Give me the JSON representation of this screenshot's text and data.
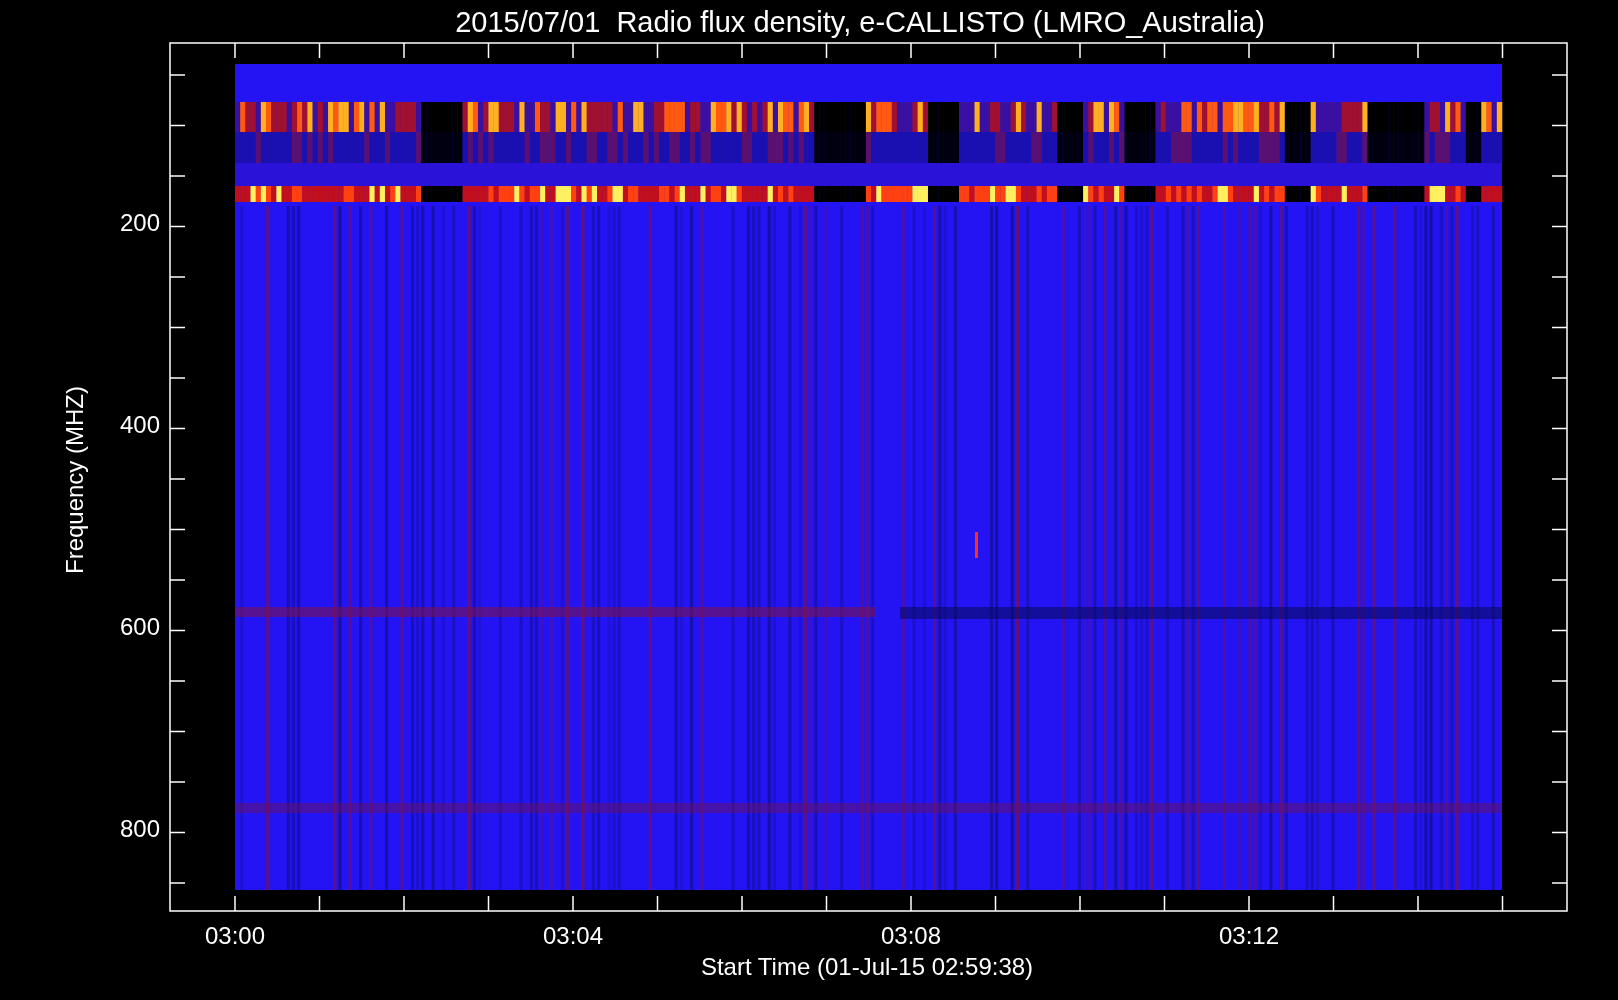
{
  "chart": {
    "title": "2015/07/01  Radio flux density, e-CALLISTO (LMRO_Australia)",
    "ylabel": "Frequency (MHZ)",
    "xlabel": "Start Time (01-Jul-15 02:59:38)",
    "yticks": [
      "200",
      "400",
      "600",
      "800"
    ],
    "xticks": [
      "03:00",
      "03:04",
      "03:08",
      "03:12"
    ]
  }
}
